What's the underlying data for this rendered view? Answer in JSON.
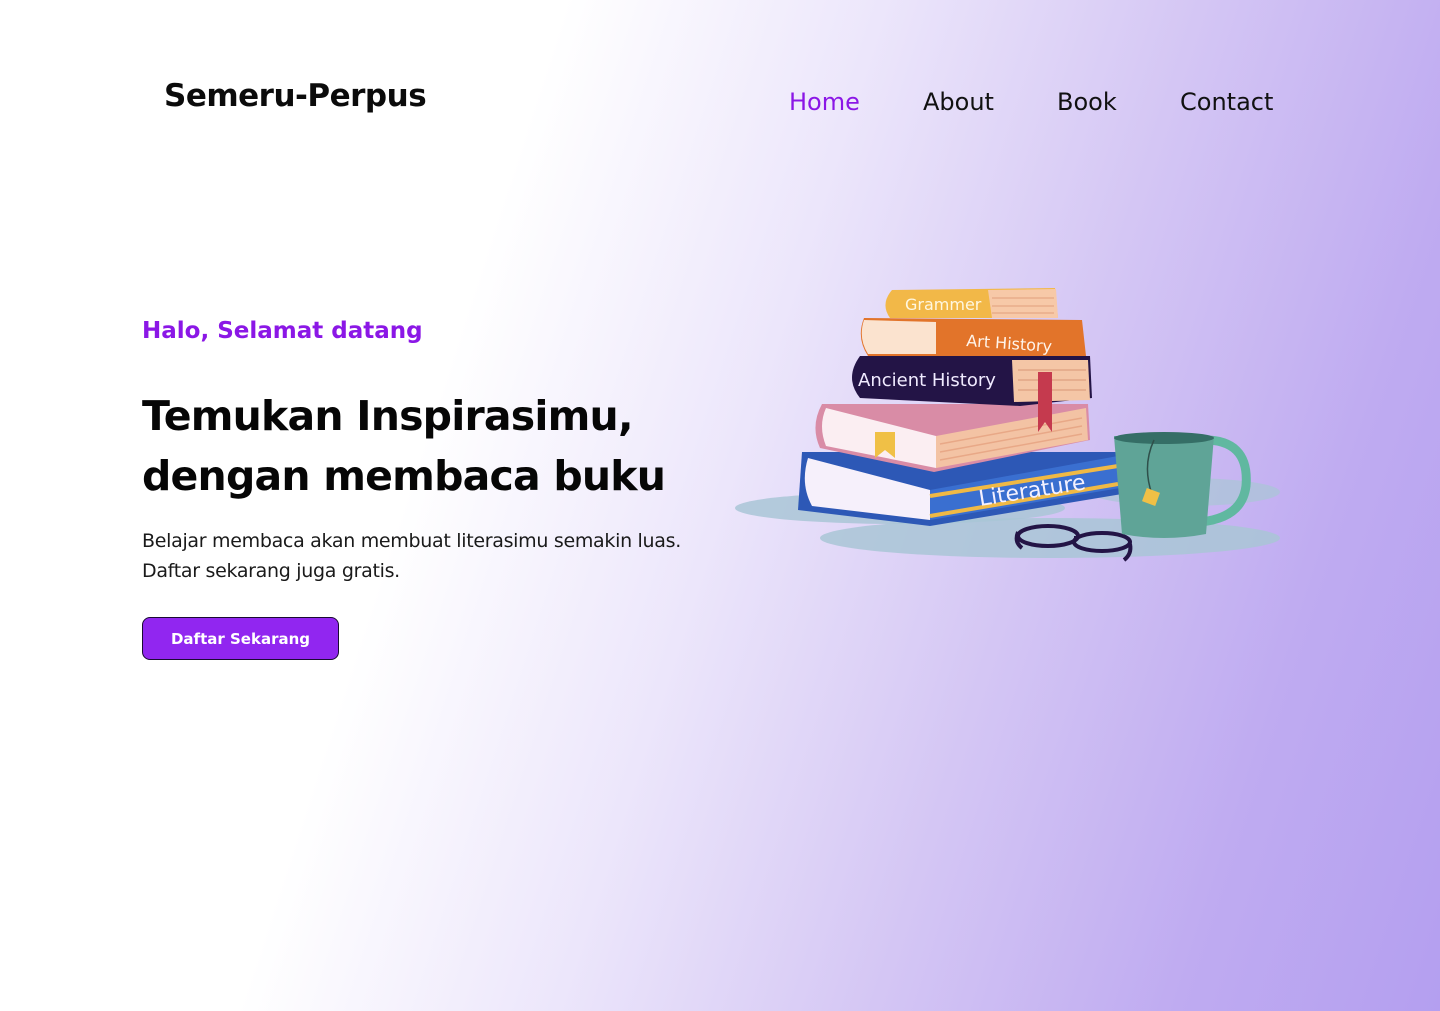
{
  "brand": {
    "name": "Semeru-Perpus"
  },
  "nav": {
    "items": [
      {
        "label": "Home",
        "active": true
      },
      {
        "label": "About",
        "active": false
      },
      {
        "label": "Book",
        "active": false
      },
      {
        "label": "Contact",
        "active": false
      }
    ]
  },
  "hero": {
    "greeting": "Halo, Selamat datang",
    "headline_line1": "Temukan Inspirasimu,",
    "headline_line2": "dengan membaca buku",
    "description_line1": "Belajar membaca akan membuat literasimu semakin luas.",
    "description_line2": "Daftar sekarang juga gratis.",
    "cta_label": "Daftar Sekarang"
  },
  "illustration": {
    "book_titles": [
      "Grammer",
      "Art History",
      "Ancient History",
      "Literature"
    ]
  },
  "colors": {
    "accent": "#8b17e6",
    "button": "#9126f0",
    "gradient_end": "#b49ff0"
  }
}
